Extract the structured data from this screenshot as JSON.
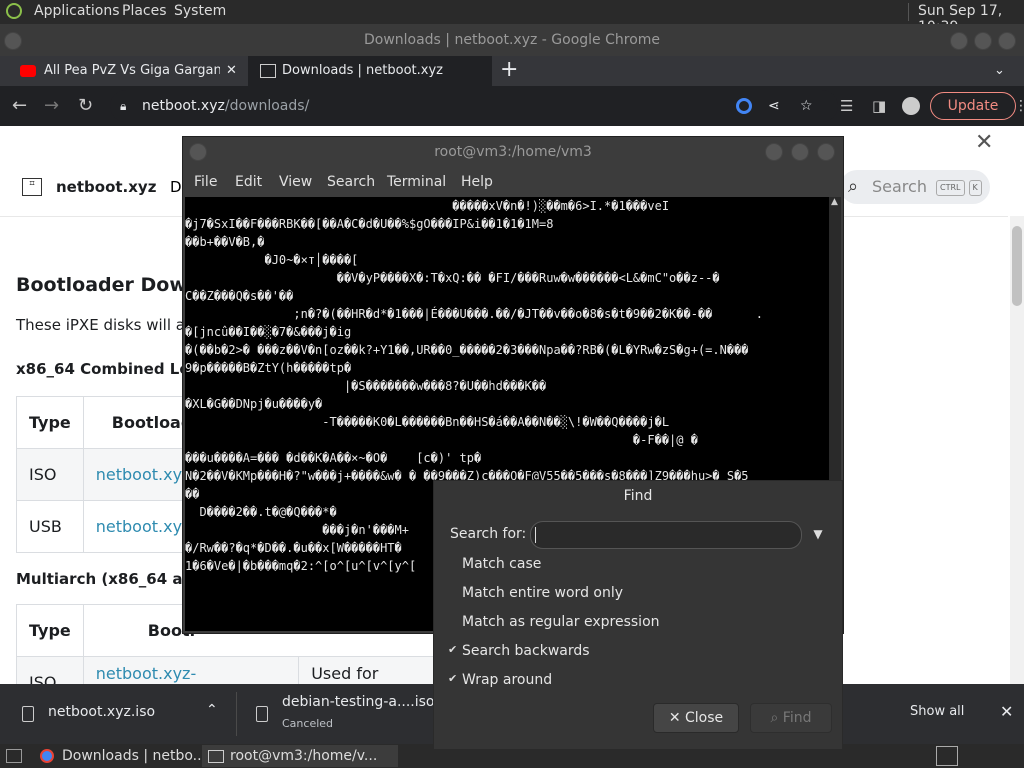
{
  "top_panel": {
    "applications": "Applications",
    "places": "Places",
    "system": "System",
    "clock": "Sun Sep 17, 10:39"
  },
  "chrome": {
    "window_title": "Downloads | netboot.xyz - Google Chrome",
    "tabs": [
      {
        "label": "All Pea PvZ Vs Giga Gargantua"
      },
      {
        "label": "Downloads | netboot.xyz"
      }
    ],
    "new_tab": "+",
    "url_host": "netboot.xyz",
    "url_path": "/downloads/",
    "update_label": "Update"
  },
  "page": {
    "site_title": "netboot.xyz",
    "nav_partial": "D",
    "search_placeholder": "Search",
    "search_kbd_1": "CTRL",
    "search_kbd_2": "K",
    "heading": "Bootloader Downl",
    "intro": "These iPXE disks will au",
    "section1": "x86_64 Combined Lega",
    "section2": "Multiarch (x86_64 and",
    "table1": {
      "headers": [
        "Type",
        "Bootloade"
      ],
      "rows": [
        [
          "ISO",
          "netboot.xyz.i"
        ],
        [
          "USB",
          "netboot.xyz.i"
        ]
      ]
    },
    "table2": {
      "headers": [
        "Type",
        "Bootl"
      ],
      "rows": [
        [
          "ISO",
          "netboot.xyz-multiarch.iso",
          "Used for CD/DVD,"
        ]
      ]
    }
  },
  "downloads": {
    "item1_name": "netboot.xyz.iso",
    "item2_name": "debian-testing-a....iso",
    "item2_status": "Canceled",
    "show_all": "Show all"
  },
  "taskbar": {
    "task1": "Downloads | netbo...",
    "task2": "root@vm3:/home/v..."
  },
  "terminal": {
    "title": "root@vm3:/home/vm3",
    "menu": [
      "File",
      "Edit",
      "View",
      "Search",
      "Terminal",
      "Help"
    ],
    "lines": [
      "                                     �����xV�n�!)░��m�6>I.*�1���veI",
      "�j7�SxI��F���RBK��[��A�C�d�U��%$gO���IP&i��1�1�1M=8",
      "��b+��V�B,�",
      "           �J0~�×т│����[",
      "                     ��V�yP����X�:T�xQ:�� �FI/���Ruw�w������<L&�mC\"o��z‐-�",
      "C��Z���Q�s��'��",
      "               ;n�?�(��HR�d*�1���|É���U���.��/�JT��v��o�8�s�t�9��2�K��-��      .",
      "�[jncû��I��░�7�&���j�ig",
      "�(��b�2>� ���z��V�n[oz��k?+Y1��,UR��0_�����2�3���Npa��?RB�(�L�YRw�zS�g+(=.N���",
      "9�p�����B�ZtY(h�����tp�",
      "                      |�S�������w���8?�U��hd���K��",
      "",
      "�XL�G��DNpj�u����y�",
      "                   -T�����K0�L������Bn��HS�á��A��N��░\\!�W��Q����j�L",
      "                                                              �-F��|@ �",
      "���u����A=��� �d��K�A��×~�O�    [c�)' tp�",
      "N�2��V�KMp���H�?\"w���j+����&w� � ��9���Z)c���Q�F@V55��5���s�8���]Z9���hu>� S�5",
      "��",
      "  D����2��.t�@�Q���*�",
      "                   ���j�n'���M+",
      "",
      "",
      "�/Rw��?�q*�D��.�u��x[W�����HT�",
      "1�6�Ve�|�b���mq�2:^[o^[u^[v^[y^["
    ]
  },
  "find": {
    "title": "Find",
    "search_label": "Search for:",
    "search_value": "",
    "options": [
      {
        "label": "Match case",
        "checked": false
      },
      {
        "label": "Match entire word only",
        "checked": false
      },
      {
        "label": "Match as regular expression",
        "checked": false
      },
      {
        "label": "Search backwards",
        "checked": true
      },
      {
        "label": "Wrap around",
        "checked": true
      }
    ],
    "close_label": "Close",
    "find_label": "Find"
  },
  "colors": {
    "chrome_dark": "#202124",
    "link": "#2e8bb0",
    "update_accent": "#f28b82"
  }
}
